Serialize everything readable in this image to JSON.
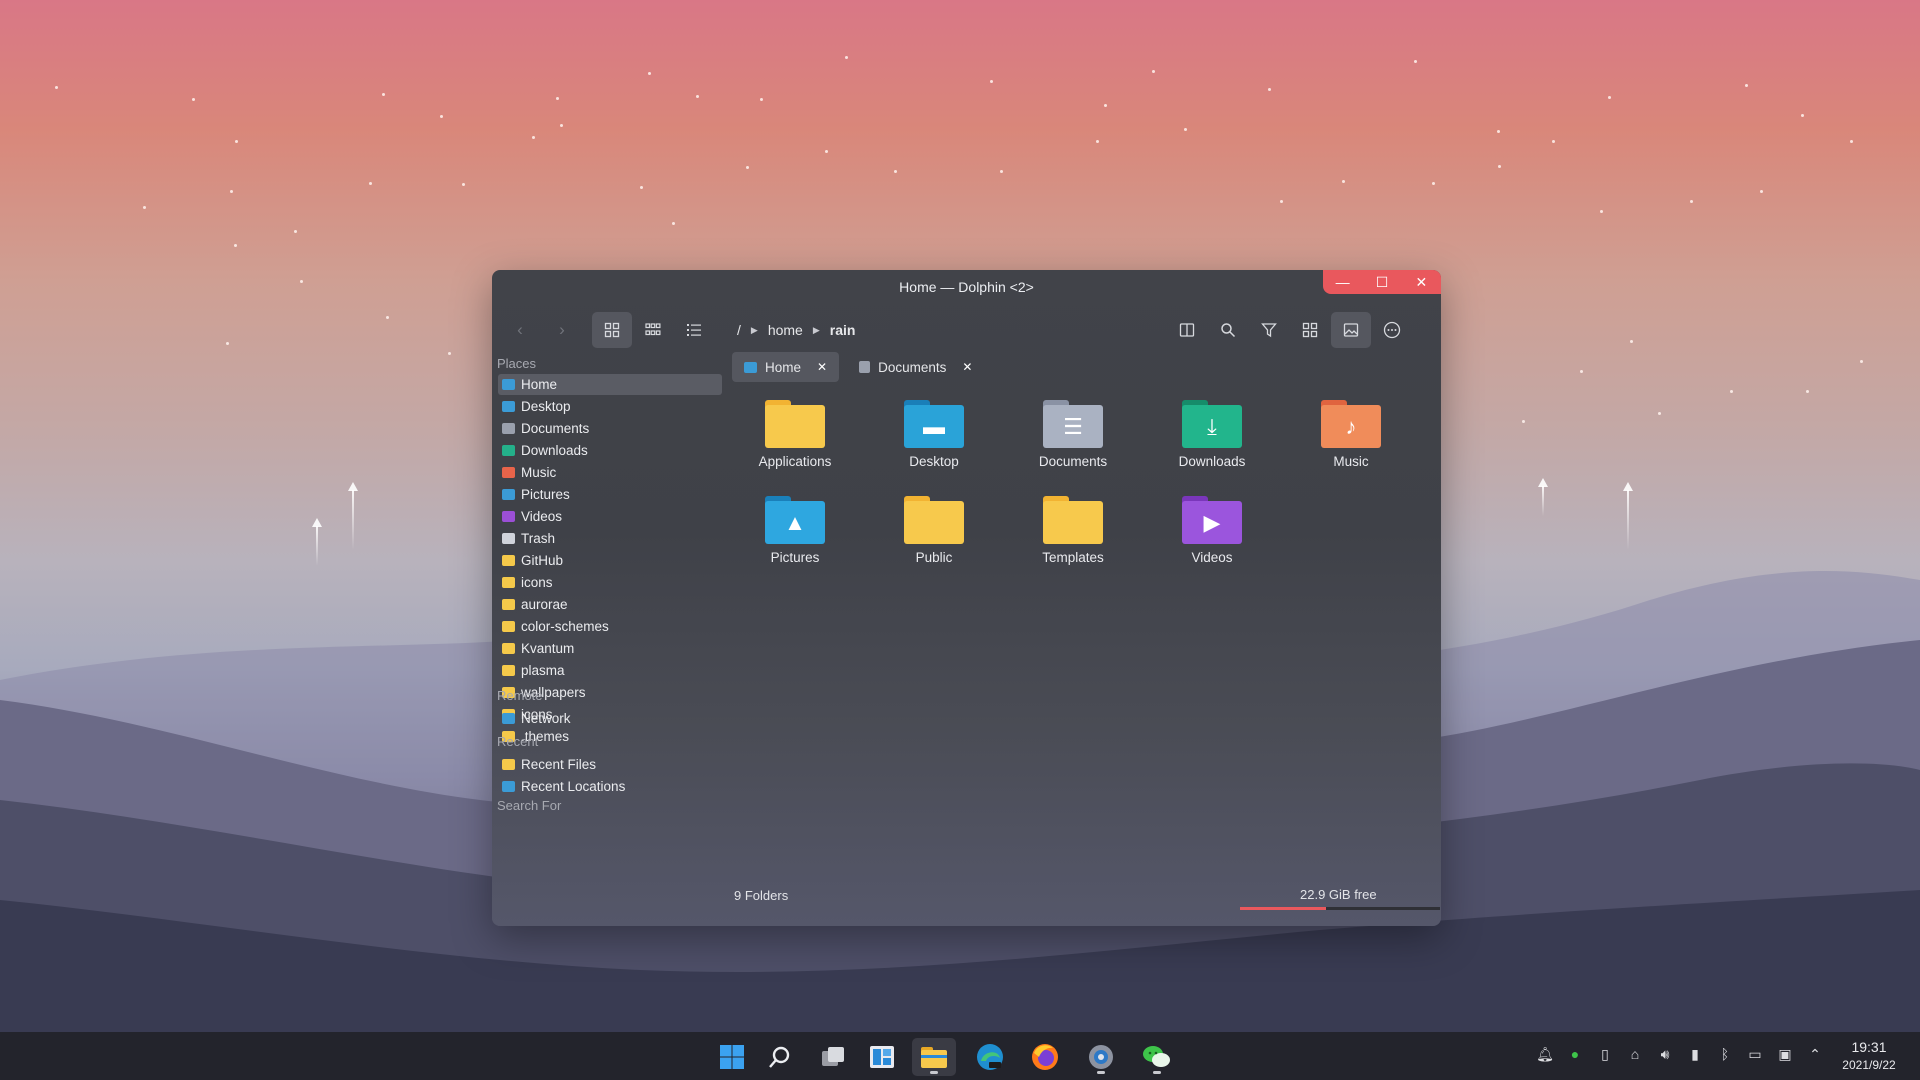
{
  "window": {
    "title": "Home — Dolphin <2>",
    "controls": [
      "—",
      "☐",
      "✕"
    ],
    "breadcrumb": {
      "root": "/",
      "segments": [
        "home",
        "rain"
      ]
    },
    "toolbar_icons": [
      "back-arrow",
      "forward-arrow",
      "icons-view",
      "compact-view",
      "details-view",
      "split-view",
      "search",
      "filter",
      "grid",
      "preview",
      "more"
    ]
  },
  "sidebar": {
    "places_title": "Places",
    "places": [
      {
        "label": "Home",
        "selected": true,
        "color": "#3b9bd6"
      },
      {
        "label": "Desktop",
        "color": "#3b9bd6"
      },
      {
        "label": "Documents",
        "color": "#9aa0ad"
      },
      {
        "label": "Downloads",
        "color": "#24b08a"
      },
      {
        "label": "Music",
        "color": "#e8644a"
      },
      {
        "label": "Pictures",
        "color": "#3b9bd6"
      },
      {
        "label": "Videos",
        "color": "#9b4fd6"
      },
      {
        "label": "Trash",
        "color": "#d0d3db"
      },
      {
        "label": "GitHub",
        "color": "#f5c94a"
      },
      {
        "label": "icons",
        "color": "#f5c94a"
      },
      {
        "label": "aurorae",
        "color": "#f5c94a"
      },
      {
        "label": "color-schemes",
        "color": "#f5c94a"
      },
      {
        "label": "Kvantum",
        "color": "#f5c94a"
      },
      {
        "label": "plasma",
        "color": "#f5c94a"
      },
      {
        "label": "wallpapers",
        "color": "#f5c94a"
      },
      {
        "label": "icons",
        "color": "#f5c94a"
      },
      {
        "label": ".themes",
        "color": "#f5c94a"
      }
    ],
    "remote_title": "Remote",
    "remote": [
      {
        "label": "Network",
        "color": "#3b9bd6"
      }
    ],
    "recent_title": "Recent",
    "recent": [
      {
        "label": "Recent Files",
        "color": "#f5c94a"
      },
      {
        "label": "Recent Locations",
        "color": "#3b9bd6"
      }
    ],
    "search_title": "Search For"
  },
  "tabs": [
    {
      "label": "Home",
      "active": true
    },
    {
      "label": "Documents",
      "active": false
    }
  ],
  "folders": [
    {
      "label": "Applications",
      "color": "#f7c94c",
      "tab": "#f2b332",
      "glyph": ""
    },
    {
      "label": "Desktop",
      "color": "#2aa3d8",
      "tab": "#1a7fb8",
      "glyph": "▬"
    },
    {
      "label": "Documents",
      "color": "#aab2c2",
      "tab": "#8a92a4",
      "glyph": "☰"
    },
    {
      "label": "Downloads",
      "color": "#22b58c",
      "tab": "#168c6a",
      "glyph": "⤓"
    },
    {
      "label": "Music",
      "color": "#f08c5a",
      "tab": "#e0643f",
      "glyph": "♪"
    },
    {
      "label": "Pictures",
      "color": "#2ea7e0",
      "tab": "#1a80ba",
      "glyph": "▲"
    },
    {
      "label": "Public",
      "color": "#f7c94c",
      "tab": "#f2b332",
      "glyph": ""
    },
    {
      "label": "Templates",
      "color": "#f7c94c",
      "tab": "#f2b332",
      "glyph": ""
    },
    {
      "label": "Videos",
      "color": "#9b55dd",
      "tab": "#7a36bb",
      "glyph": "▶"
    }
  ],
  "status": {
    "count": "9 Folders",
    "free": "22.9 GiB free",
    "used_fraction": 0.43
  },
  "taskbar": {
    "apps": [
      "windows-start",
      "search",
      "task-view",
      "widgets",
      "file-explorer",
      "edge-dev",
      "firefox",
      "settings",
      "wechat"
    ],
    "tray_icons": [
      "bell",
      "wechat",
      "clipboard",
      "network",
      "volume",
      "battery",
      "bluetooth",
      "display",
      "monitor",
      "chevron-up"
    ],
    "time": "19:31",
    "date": "2021/9/22"
  }
}
